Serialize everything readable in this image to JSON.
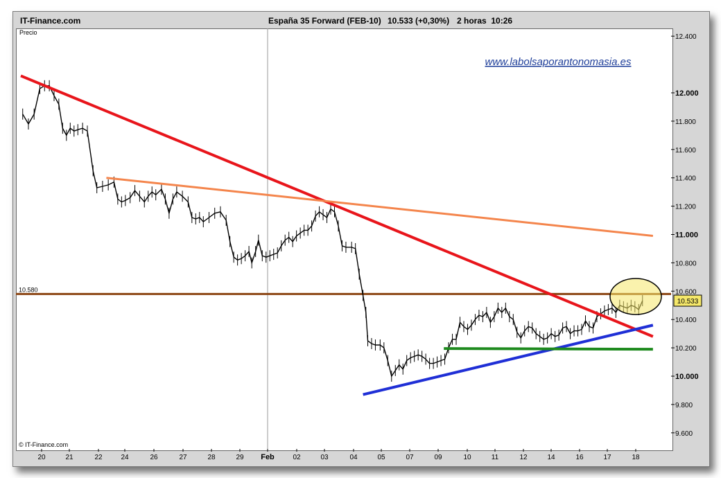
{
  "header": {
    "site": "IT-Finance.com",
    "instrument": "España 35 Forward (FEB-10)",
    "price_change": "10.533 (+0,30%)",
    "interval": "2 horas",
    "time": "10:26"
  },
  "watermark_url": "www.labolsaporantonomasia.es",
  "copyright": "© IT-Finance.com",
  "colors": {
    "price": "#000000",
    "downtrend": "#e8151b",
    "upper_trend": "#f4854c",
    "resistance": "#8b4513",
    "support": "#1e8a1e",
    "uptrend": "#1f2fd6",
    "highlight": "#f5e86a",
    "url": "#1f3f9a"
  },
  "chart_data": {
    "type": "line",
    "title": "España 35 Forward (FEB-10)",
    "ylabel": "Precio",
    "xlabel": "",
    "ylim": [
      9500,
      12500
    ],
    "x_ticks": [
      "20",
      "21",
      "22",
      "24",
      "26",
      "27",
      "28",
      "29",
      "Feb",
      "02",
      "03",
      "04",
      "05",
      "07",
      "09",
      "10",
      "11",
      "12",
      "14",
      "16",
      "17",
      "18"
    ],
    "y_ticks": [
      12400,
      12000,
      11800,
      11600,
      11400,
      11200,
      11000,
      10800,
      10600,
      10400,
      10200,
      10000,
      9800,
      9600
    ],
    "y_tick_labels": [
      "12.400",
      "12.000",
      "11.800",
      "11.600",
      "11.400",
      "11.200",
      "11.000",
      "10.800",
      "10.600",
      "10.400",
      "10.200",
      "10.000",
      "9.800",
      "9.600"
    ],
    "bold_ticks": [
      12000,
      11000,
      10000
    ],
    "last_price": 10533,
    "last_price_label": "10.533",
    "resistance_level": 10580,
    "resistance_label": "10.580",
    "grid": false,
    "series": [
      {
        "values": [
          [
            0.2,
            11850
          ],
          [
            0.8,
            11780
          ],
          [
            1.4,
            11850
          ],
          [
            2.0,
            12030
          ],
          [
            2.5,
            12050
          ],
          [
            3.0,
            12050
          ],
          [
            3.5,
            11980
          ],
          [
            4.0,
            11920
          ],
          [
            4.4,
            11750
          ],
          [
            4.8,
            11700
          ],
          [
            5.2,
            11750
          ],
          [
            5.6,
            11730
          ],
          [
            6.0,
            11740
          ],
          [
            6.5,
            11750
          ],
          [
            7.0,
            11730
          ],
          [
            7.6,
            11450
          ],
          [
            8.0,
            11330
          ],
          [
            8.6,
            11340
          ],
          [
            9.2,
            11350
          ],
          [
            9.8,
            11370
          ],
          [
            10.2,
            11250
          ],
          [
            10.6,
            11230
          ],
          [
            11.0,
            11240
          ],
          [
            11.5,
            11260
          ],
          [
            12.0,
            11310
          ],
          [
            12.5,
            11270
          ],
          [
            13.0,
            11230
          ],
          [
            13.4,
            11270
          ],
          [
            13.8,
            11300
          ],
          [
            14.2,
            11280
          ],
          [
            14.8,
            11320
          ],
          [
            15.2,
            11250
          ],
          [
            15.6,
            11150
          ],
          [
            16.0,
            11250
          ],
          [
            16.4,
            11300
          ],
          [
            17.0,
            11270
          ],
          [
            17.6,
            11230
          ],
          [
            18.0,
            11120
          ],
          [
            18.4,
            11110
          ],
          [
            18.8,
            11120
          ],
          [
            19.2,
            11090
          ],
          [
            19.8,
            11120
          ],
          [
            20.4,
            11150
          ],
          [
            21.0,
            11160
          ],
          [
            21.6,
            11100
          ],
          [
            22.0,
            10950
          ],
          [
            22.4,
            10840
          ],
          [
            22.8,
            10820
          ],
          [
            23.2,
            10830
          ],
          [
            23.6,
            10850
          ],
          [
            24.0,
            10880
          ],
          [
            24.3,
            10800
          ],
          [
            24.7,
            10880
          ],
          [
            25.0,
            10960
          ],
          [
            25.4,
            10850
          ],
          [
            25.8,
            10840
          ],
          [
            26.2,
            10850
          ],
          [
            26.6,
            10860
          ],
          [
            27.0,
            10870
          ],
          [
            27.4,
            10920
          ],
          [
            27.8,
            10960
          ],
          [
            28.2,
            10980
          ],
          [
            28.6,
            10950
          ],
          [
            29.0,
            10990
          ],
          [
            29.4,
            11010
          ],
          [
            29.8,
            11030
          ],
          [
            30.2,
            11030
          ],
          [
            30.6,
            11060
          ],
          [
            31.0,
            11130
          ],
          [
            31.4,
            11160
          ],
          [
            31.8,
            11140
          ],
          [
            32.2,
            11120
          ],
          [
            32.6,
            11180
          ],
          [
            33.0,
            11160
          ],
          [
            33.4,
            11060
          ],
          [
            33.8,
            10920
          ],
          [
            34.2,
            10910
          ],
          [
            34.8,
            10910
          ],
          [
            35.2,
            10900
          ],
          [
            35.6,
            10720
          ],
          [
            36.0,
            10570
          ],
          [
            36.3,
            10450
          ],
          [
            36.5,
            10250
          ],
          [
            36.9,
            10230
          ],
          [
            37.3,
            10220
          ],
          [
            37.8,
            10220
          ],
          [
            38.2,
            10200
          ],
          [
            38.6,
            10110
          ],
          [
            39.0,
            10000
          ],
          [
            39.4,
            10040
          ],
          [
            39.8,
            10080
          ],
          [
            40.2,
            10050
          ],
          [
            40.6,
            10110
          ],
          [
            41.0,
            10130
          ],
          [
            41.4,
            10140
          ],
          [
            41.8,
            10150
          ],
          [
            42.2,
            10140
          ],
          [
            42.6,
            10120
          ],
          [
            43.0,
            10090
          ],
          [
            43.4,
            10090
          ],
          [
            43.8,
            10100
          ],
          [
            44.2,
            10110
          ],
          [
            44.6,
            10120
          ],
          [
            45.0,
            10200
          ],
          [
            45.4,
            10260
          ],
          [
            45.8,
            10260
          ],
          [
            46.2,
            10380
          ],
          [
            46.6,
            10350
          ],
          [
            47.0,
            10330
          ],
          [
            47.4,
            10360
          ],
          [
            47.8,
            10400
          ],
          [
            48.2,
            10430
          ],
          [
            48.6,
            10420
          ],
          [
            49.0,
            10450
          ],
          [
            49.4,
            10380
          ],
          [
            49.8,
            10420
          ],
          [
            50.2,
            10480
          ],
          [
            50.6,
            10450
          ],
          [
            51.0,
            10480
          ],
          [
            51.4,
            10420
          ],
          [
            51.8,
            10400
          ],
          [
            52.2,
            10310
          ],
          [
            52.6,
            10270
          ],
          [
            53.0,
            10320
          ],
          [
            53.4,
            10350
          ],
          [
            53.8,
            10340
          ],
          [
            54.2,
            10300
          ],
          [
            54.6,
            10280
          ],
          [
            55.0,
            10260
          ],
          [
            55.4,
            10270
          ],
          [
            55.8,
            10300
          ],
          [
            56.2,
            10280
          ],
          [
            56.6,
            10290
          ],
          [
            57.0,
            10340
          ],
          [
            57.4,
            10350
          ],
          [
            57.8,
            10300
          ],
          [
            58.2,
            10320
          ],
          [
            58.6,
            10320
          ],
          [
            59.0,
            10330
          ],
          [
            59.4,
            10390
          ],
          [
            59.8,
            10350
          ],
          [
            60.2,
            10340
          ],
          [
            60.6,
            10420
          ],
          [
            61.0,
            10440
          ],
          [
            61.4,
            10460
          ],
          [
            61.8,
            10470
          ],
          [
            62.2,
            10480
          ],
          [
            62.6,
            10450
          ],
          [
            63.0,
            10500
          ],
          [
            63.4,
            10490
          ],
          [
            63.8,
            10480
          ],
          [
            64.2,
            10500
          ],
          [
            64.6,
            10490
          ],
          [
            65.0,
            10470
          ],
          [
            65.4,
            10533
          ]
        ]
      }
    ],
    "trendlines": [
      {
        "name": "downtrend",
        "from": [
          0.0,
          12120
        ],
        "to": [
          66.5,
          10280
        ]
      },
      {
        "name": "upper_trend",
        "from": [
          9.0,
          11400
        ],
        "to": [
          66.5,
          10990
        ]
      },
      {
        "name": "uptrend",
        "from": [
          36.0,
          9870
        ],
        "to": [
          66.5,
          10360
        ]
      },
      {
        "name": "support",
        "from": [
          44.5,
          10195
        ],
        "to": [
          66.5,
          10190
        ]
      }
    ]
  }
}
